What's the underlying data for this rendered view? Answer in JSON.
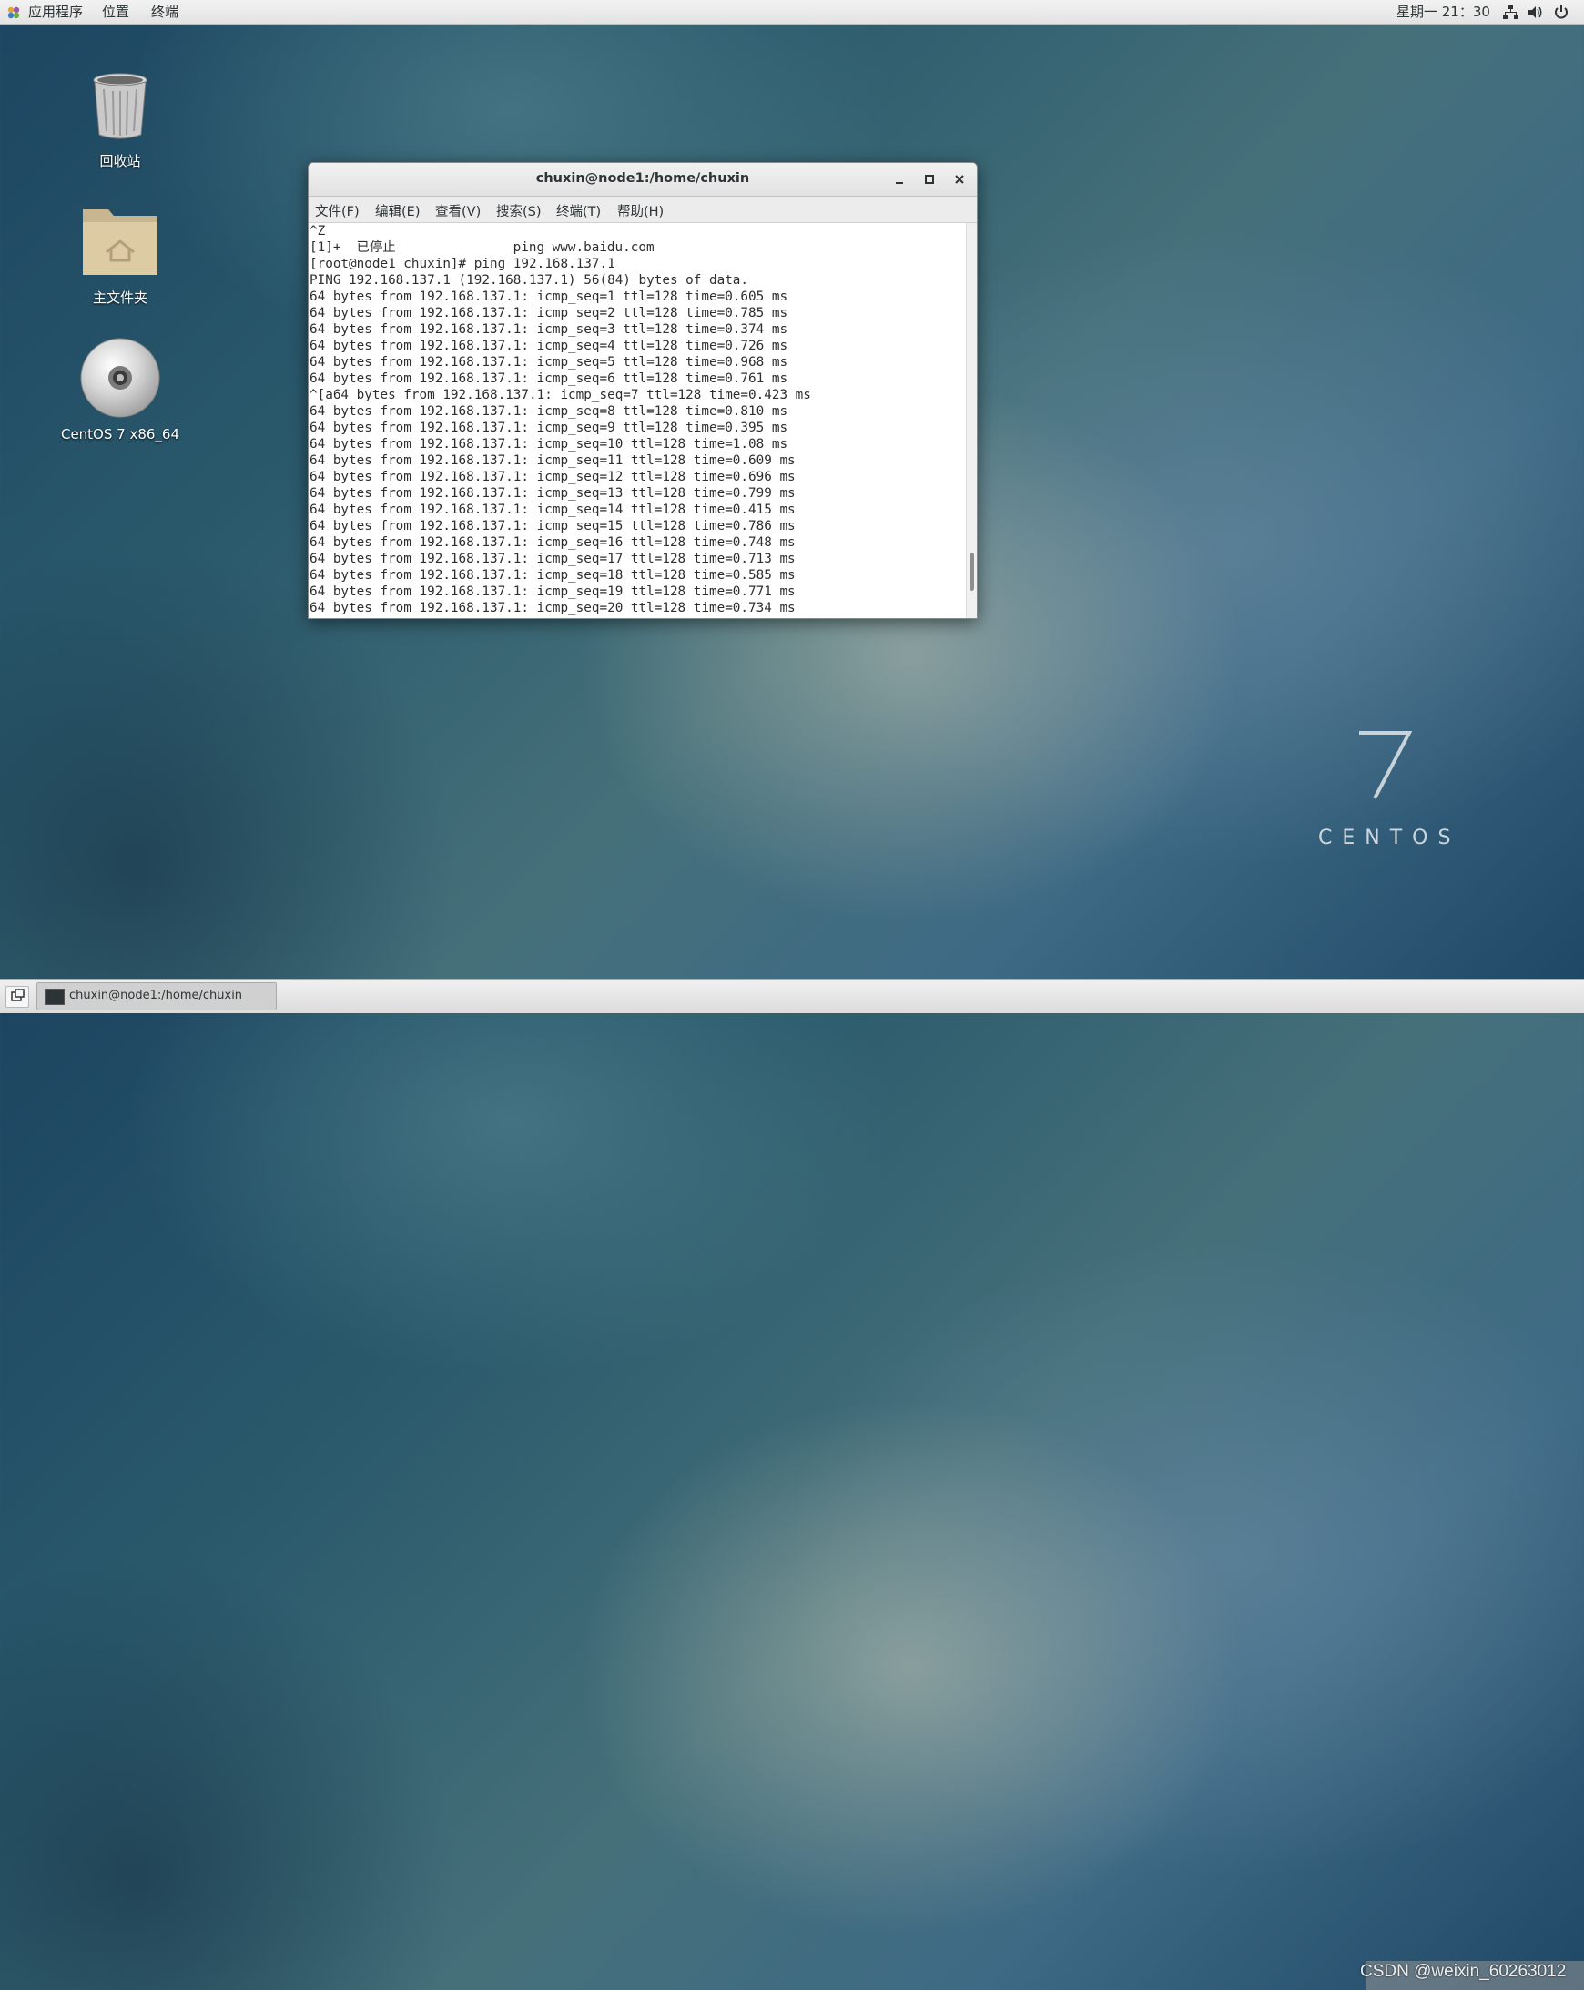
{
  "topbar": {
    "apps": "应用程序",
    "places": "位置",
    "terminal": "终端",
    "clock": "星期一 21：30"
  },
  "desktop": {
    "trash": "回收站",
    "home": "主文件夹",
    "dvd": "CentOS 7 x86_64"
  },
  "logo": {
    "number": "7",
    "word": "CENTOS"
  },
  "window": {
    "title": "chuxin@node1:/home/chuxin",
    "menu": [
      "文件(F)",
      "编辑(E)",
      "查看(V)",
      "搜索(S)",
      "终端(T)",
      "帮助(H)"
    ]
  },
  "terminal_lines": [
    "^Z",
    "[1]+  已停止               ping www.baidu.com",
    "[root@node1 chuxin]# ping 192.168.137.1",
    "PING 192.168.137.1 (192.168.137.1) 56(84) bytes of data.",
    "64 bytes from 192.168.137.1: icmp_seq=1 ttl=128 time=0.605 ms",
    "64 bytes from 192.168.137.1: icmp_seq=2 ttl=128 time=0.785 ms",
    "64 bytes from 192.168.137.1: icmp_seq=3 ttl=128 time=0.374 ms",
    "64 bytes from 192.168.137.1: icmp_seq=4 ttl=128 time=0.726 ms",
    "64 bytes from 192.168.137.1: icmp_seq=5 ttl=128 time=0.968 ms",
    "64 bytes from 192.168.137.1: icmp_seq=6 ttl=128 time=0.761 ms",
    "^[a64 bytes from 192.168.137.1: icmp_seq=7 ttl=128 time=0.423 ms",
    "64 bytes from 192.168.137.1: icmp_seq=8 ttl=128 time=0.810 ms",
    "64 bytes from 192.168.137.1: icmp_seq=9 ttl=128 time=0.395 ms",
    "64 bytes from 192.168.137.1: icmp_seq=10 ttl=128 time=1.08 ms",
    "64 bytes from 192.168.137.1: icmp_seq=11 ttl=128 time=0.609 ms",
    "64 bytes from 192.168.137.1: icmp_seq=12 ttl=128 time=0.696 ms",
    "64 bytes from 192.168.137.1: icmp_seq=13 ttl=128 time=0.799 ms",
    "64 bytes from 192.168.137.1: icmp_seq=14 ttl=128 time=0.415 ms",
    "64 bytes from 192.168.137.1: icmp_seq=15 ttl=128 time=0.786 ms",
    "64 bytes from 192.168.137.1: icmp_seq=16 ttl=128 time=0.748 ms",
    "64 bytes from 192.168.137.1: icmp_seq=17 ttl=128 time=0.713 ms",
    "64 bytes from 192.168.137.1: icmp_seq=18 ttl=128 time=0.585 ms",
    "64 bytes from 192.168.137.1: icmp_seq=19 ttl=128 time=0.771 ms",
    "64 bytes from 192.168.137.1: icmp_seq=20 ttl=128 time=0.734 ms"
  ],
  "taskbar": {
    "item": "chuxin@node1:/home/chuxin"
  },
  "watermark": "CSDN @weixin_60263012",
  "icons": {
    "apps": "apps-menu-icon",
    "network": "network-icon",
    "volume": "volume-icon",
    "power": "power-icon",
    "minimize": "minimize-icon",
    "maximize": "maximize-icon",
    "close": "close-icon"
  }
}
